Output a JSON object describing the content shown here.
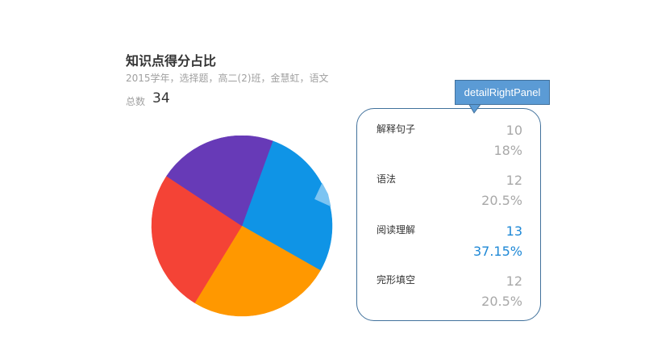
{
  "header": {
    "title": "知识点得分占比",
    "subtitle": "2015学年，选择题，高二(2)班，金慧虹，语文",
    "total_label": "总数",
    "total_value": "34"
  },
  "chart_data": {
    "type": "pie",
    "title": "知识点得分占比",
    "slices": [
      {
        "label": "阅读理解",
        "value": 13,
        "percent": "37.15%",
        "color": "#0f94e6"
      },
      {
        "label": "完形填空",
        "value": 12,
        "percent": "20.5%",
        "color": "#ff9800"
      },
      {
        "label": "语法",
        "value": 12,
        "percent": "20.5%",
        "color": "#f44336"
      },
      {
        "label": "解释句子",
        "value": 10,
        "percent": "18%",
        "color": "#673ab7"
      }
    ],
    "selected": "阅读理解"
  },
  "detail_panel": {
    "items": [
      {
        "name": "解释句子",
        "count": "10",
        "percent": "18%",
        "active": false
      },
      {
        "name": "语法",
        "count": "12",
        "percent": "20.5%",
        "active": false
      },
      {
        "name": "阅读理解",
        "count": "13",
        "percent": "37.15%",
        "active": true
      },
      {
        "name": "完形填空",
        "count": "12",
        "percent": "20.5%",
        "active": false
      }
    ]
  },
  "callout": {
    "label": "detailRightPanel"
  },
  "colors": {
    "accent": "#1e88d6",
    "panel_border": "#41719c",
    "callout_fill": "#5b9bd5",
    "indicator": "#7cc4f2"
  }
}
